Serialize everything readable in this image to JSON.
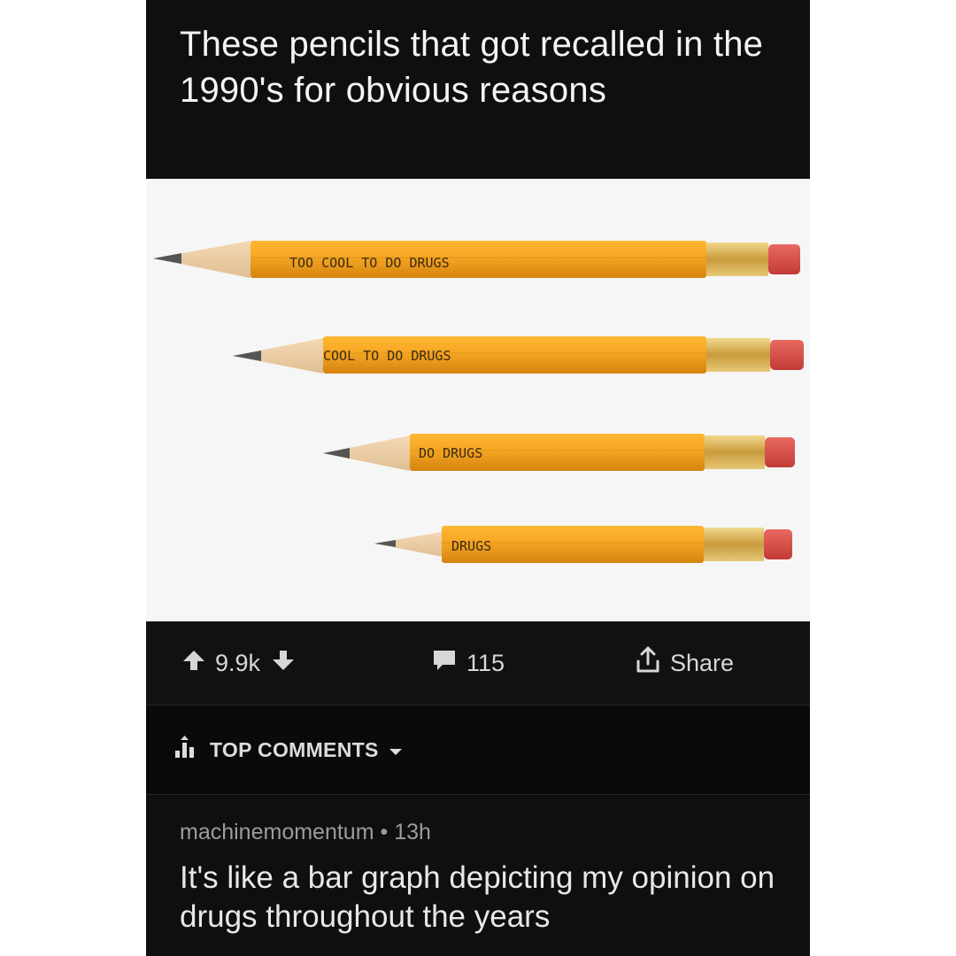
{
  "post": {
    "title": "These pencils that got recalled in the 1990's for obvious reasons",
    "image": {
      "pencils": [
        {
          "text": "TOO COOL TO DO DRUGS"
        },
        {
          "text": "COOL TO DO DRUGS"
        },
        {
          "text": "DO DRUGS"
        },
        {
          "text": "DRUGS"
        }
      ]
    }
  },
  "actions": {
    "score": "9.9k",
    "comment_count": "115",
    "share_label": "Share"
  },
  "sort": {
    "label": "TOP COMMENTS"
  },
  "comment": {
    "author": "machinemomentum",
    "separator": "•",
    "age": "13h",
    "text": "It's like a bar graph depicting my opinion on drugs throughout the years"
  },
  "colors": {
    "pencil_body": "#f5a623",
    "eraser": "#d94a44",
    "ferrule": "#d9b45b",
    "background_dark": "#0f0f0f"
  }
}
